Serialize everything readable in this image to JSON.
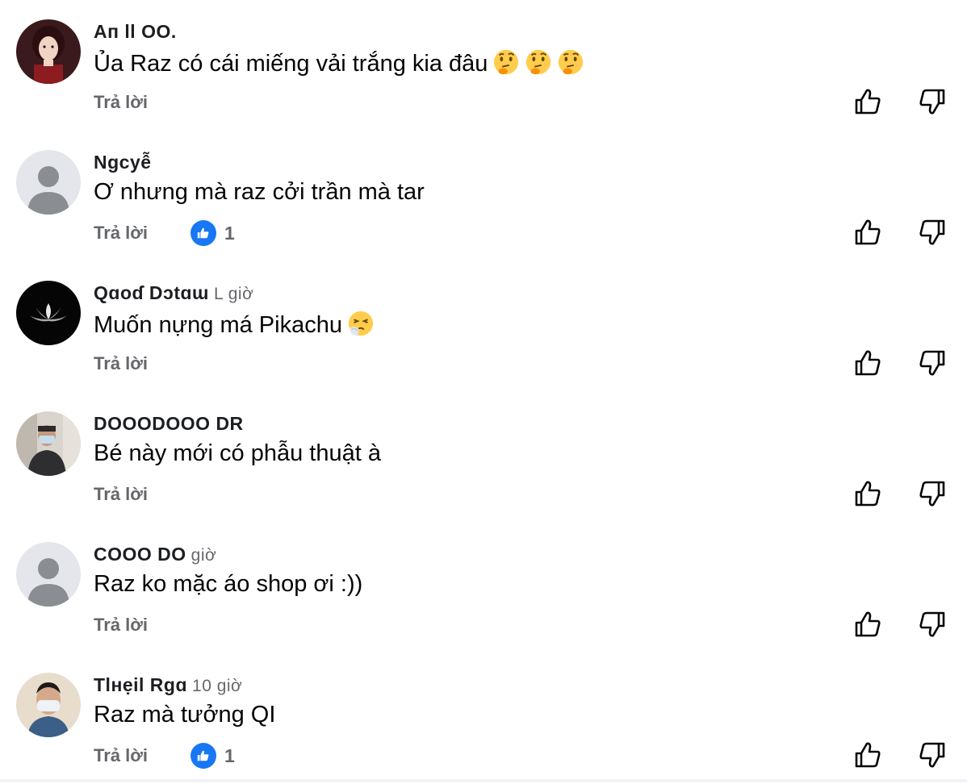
{
  "comments": [
    {
      "author": "Aп ll OO.",
      "time": "",
      "text": "Ủa Raz có cái miếng vải trắng kia đâu",
      "emoji_names": [
        "thinking-face-emoji",
        "thinking-face-emoji",
        "thinking-face-emoji"
      ],
      "reply_label": "Trả lời",
      "likes": "",
      "avatar": "anime-girl-avatar"
    },
    {
      "author": "Ngcyễ",
      "time": "",
      "text": "Ơ nhưng mà raz cởi trần mà tar",
      "emoji_names": [],
      "reply_label": "Trả lời",
      "likes": "1",
      "avatar": "default-avatar"
    },
    {
      "author": "Qɑoɗ Dɔtɑɯ",
      "time": "L giờ",
      "text": "Muốn nựng má Pikachu",
      "emoji_names": [
        "sneezing-face-emoji"
      ],
      "reply_label": "Trả lời",
      "likes": "",
      "avatar": "lotus-avatar"
    },
    {
      "author": "DOOODOOO DR",
      "time": "",
      "text": "Bé này mới có phẫu thuật à",
      "emoji_names": [],
      "reply_label": "Trả lời",
      "likes": "",
      "avatar": "man-selfie-avatar"
    },
    {
      "author": "COOO DO",
      "time": "giờ",
      "text": "Raz ko mặc áo shop ơi :))",
      "emoji_names": [],
      "reply_label": "Trả lời",
      "likes": "",
      "avatar": "default-avatar"
    },
    {
      "author": "Tlнẹil Rgɑ",
      "time": "10 giờ",
      "text": "Raz mà tưởng QI",
      "emoji_names": [],
      "reply_label": "Trả lời",
      "likes": "1",
      "avatar": "masked-man-avatar"
    }
  ],
  "colors": {
    "text": "#050505",
    "secondary": "#65676b",
    "like_blue": "#1877f2",
    "default_avatar_bg": "#e4e6eb",
    "default_avatar_fg": "#8a8d91"
  }
}
